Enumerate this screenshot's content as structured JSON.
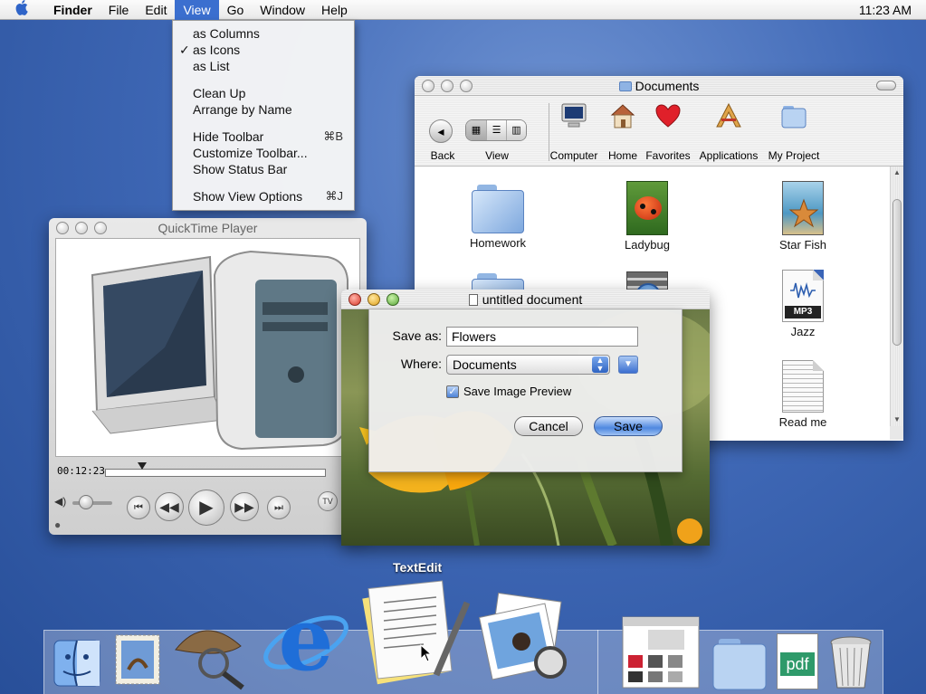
{
  "menubar": {
    "app_name": "Finder",
    "menus": [
      "File",
      "Edit",
      "View",
      "Go",
      "Window",
      "Help"
    ],
    "clock": "11:23 AM"
  },
  "view_menu": {
    "items": [
      {
        "label": "as Columns",
        "checked": false,
        "shortcut": ""
      },
      {
        "label": "as Icons",
        "checked": true,
        "shortcut": ""
      },
      {
        "label": "as List",
        "checked": false,
        "shortcut": ""
      },
      {
        "label": "Clean Up",
        "checked": false,
        "shortcut": ""
      },
      {
        "label": "Arrange by Name",
        "checked": false,
        "shortcut": ""
      },
      {
        "label": "Hide Toolbar",
        "checked": false,
        "shortcut": "⌘B"
      },
      {
        "label": "Customize Toolbar...",
        "checked": false,
        "shortcut": ""
      },
      {
        "label": "Show Status Bar",
        "checked": false,
        "shortcut": ""
      },
      {
        "label": "Show View Options",
        "checked": false,
        "shortcut": "⌘J"
      }
    ],
    "check_mark": "✓"
  },
  "finder": {
    "title": "Documents",
    "toolbar": {
      "back": "Back",
      "view": "View",
      "computer": "Computer",
      "home": "Home",
      "favorites": "Favorites",
      "applications": "Applications",
      "my_project": "My Project"
    },
    "files": [
      "Homework",
      "Ladybug",
      "Star Fish",
      "Jazz",
      "Read me"
    ],
    "mp3_badge": "MP3"
  },
  "quicktime": {
    "title": "QuickTime Player",
    "timecode": "00:12:23",
    "progress_fraction": 0.17,
    "volume_fraction": 0.35
  },
  "save_dialog": {
    "title": "untitled document",
    "save_as_label": "Save as:",
    "save_as_value": "Flowers",
    "where_label": "Where:",
    "where_value": "Documents",
    "preview_label": "Save Image Preview",
    "preview_checked": true,
    "cancel": "Cancel",
    "save": "Save"
  },
  "dock": {
    "hover_label": "TextEdit",
    "pdf_badge": "pdf"
  },
  "colors": {
    "desktop": "#3f68b6",
    "menu_highlight": "#3b6fcf",
    "aqua_blue": "#4f88e0"
  }
}
